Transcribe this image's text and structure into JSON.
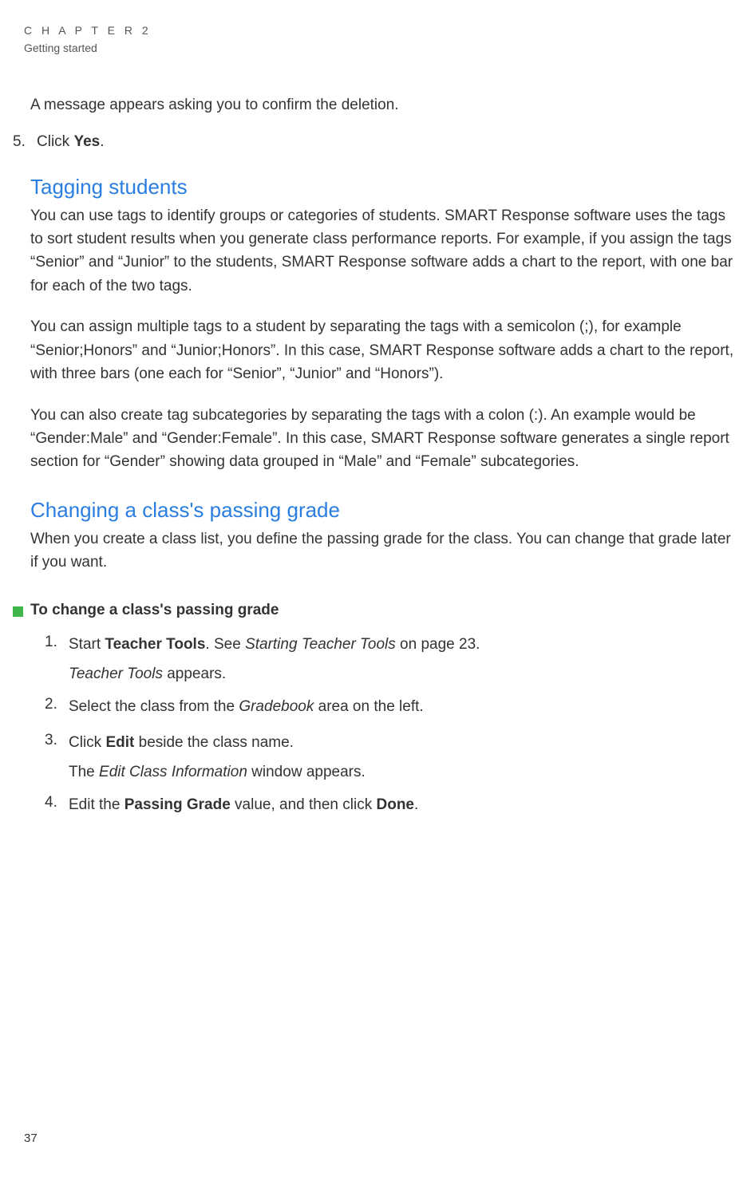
{
  "header": {
    "chapter": "C H A P T E R  2",
    "subtitle": "Getting started"
  },
  "intro": {
    "confirm_msg": "A message appears asking you to confirm the deletion.",
    "step5_num": "5.",
    "step5_prefix": "Click ",
    "step5_bold": "Yes",
    "step5_suffix": "."
  },
  "tagging": {
    "heading": "Tagging students",
    "p1": "You can use tags to identify groups or categories of students. SMART Response software uses the tags to sort student results when you generate class performance reports. For example, if you assign the tags “Senior” and “Junior” to the students, SMART Response software adds a chart to the report, with one bar for each of the two tags.",
    "p2": "You can assign multiple tags to a student by separating the tags with a semicolon (;), for example “Senior;Honors” and “Junior;Honors”. In this case, SMART Response software adds a chart to the report, with three bars (one each for “Senior”, “Junior” and “Honors”).",
    "p3": "You can also create tag subcategories by separating the tags with a colon (:). An example would be “Gender:Male” and “Gender:Female”. In this case, SMART Response software generates a single report section for “Gender” showing data grouped in “Male” and “Female” subcategories."
  },
  "changing": {
    "heading": "Changing a class's passing grade",
    "intro": "When you create a class list, you define the passing grade for the class. You can change that grade later if you want.",
    "procedure_title": "To change a class's passing grade",
    "step1_num": "1.",
    "step1_a": "Start ",
    "step1_b": "Teacher Tools",
    "step1_c": ". See ",
    "step1_d": "Starting Teacher Tools",
    "step1_e": " on page 23.",
    "step1_sub_a": "Teacher Tools",
    "step1_sub_b": " appears.",
    "step2_num": "2.",
    "step2_a": "Select the class from the ",
    "step2_b": "Gradebook",
    "step2_c": " area on the left.",
    "step3_num": "3.",
    "step3_a": "Click ",
    "step3_b": "Edit",
    "step3_c": " beside the class name.",
    "step3_sub_a": "The ",
    "step3_sub_b": "Edit Class Information",
    "step3_sub_c": " window appears.",
    "step4_num": "4.",
    "step4_a": "Edit the ",
    "step4_b": "Passing Grade",
    "step4_c": " value, and then click ",
    "step4_d": "Done",
    "step4_e": "."
  },
  "page_number": "37"
}
